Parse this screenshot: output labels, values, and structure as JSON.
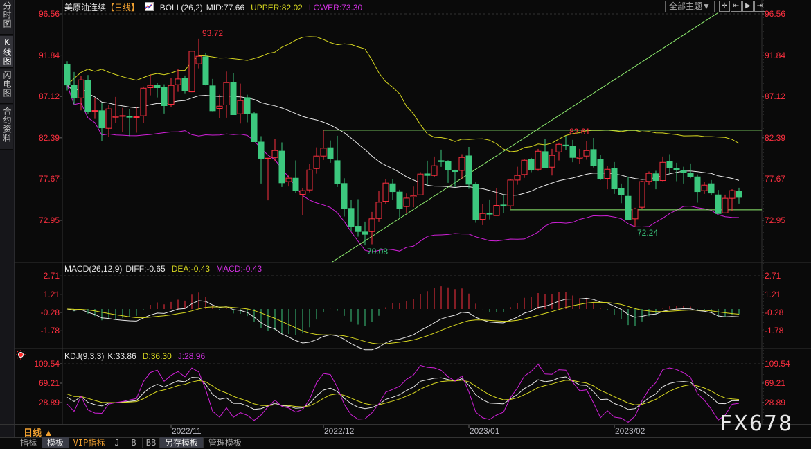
{
  "sidebar": {
    "tabs": [
      {
        "label": "分时图",
        "chars": [
          "分",
          "时",
          "图"
        ]
      },
      {
        "label": "K线图",
        "chars": [
          "K",
          "线",
          "图"
        ]
      },
      {
        "label": "闪电图",
        "chars": [
          "闪",
          "电",
          "图"
        ]
      },
      {
        "label": "合约资料",
        "chars": [
          "合",
          "约",
          "资",
          "料"
        ]
      }
    ]
  },
  "main_legend": {
    "symbol": "美原油连续",
    "period": "【日线】",
    "indicator": "BOLL(26,2)",
    "mid": "MID:77.66",
    "upper": "UPPER:82.02",
    "lower": "LOWER:73.30"
  },
  "toolbar": {
    "theme_select": "全部主题▼",
    "icons": [
      "crosshair-icon",
      "zoom-in-icon",
      "play-forward-icon",
      "exit-icon"
    ]
  },
  "macd_legend": {
    "name": "MACD(26,12,9)",
    "diff": "DIFF:-0.65",
    "dea": "DEA:-0.43",
    "macd": "MACD:-0.43"
  },
  "kdj_legend": {
    "name": "KDJ(9,3,3)",
    "k": "K:33.86",
    "d": "D:36.30",
    "j": "J:28.96"
  },
  "annotations": {
    "high": "93.72",
    "low": "70.08",
    "high2": "82.61",
    "low2": "72.24"
  },
  "period_button": "日线 ▲",
  "bottom_tabs": [
    "指标",
    "模板",
    "VIP指标",
    "J",
    "B",
    "BB",
    "另存模板",
    "管理模板"
  ],
  "watermark": "FX678",
  "colors": {
    "up": "#ff3040",
    "down": "#3cc87e",
    "mid": "#e8e8e8",
    "upper": "#d8d820",
    "lower": "#d020d8",
    "trend": "#90f070"
  },
  "chart_data": {
    "type": "candlestick",
    "title": "美原油连续【日线】",
    "price_axis": {
      "ticks": [
        96.56,
        91.84,
        87.12,
        82.39,
        77.67,
        72.95
      ],
      "range": [
        72.95,
        96.56
      ]
    },
    "macd_axis": {
      "ticks": [
        "2.71",
        "1.21",
        "-0.28",
        "-1.78"
      ],
      "values": [
        2.71,
        1.21,
        -0.28,
        -1.78
      ]
    },
    "kdj_axis": {
      "ticks": [
        "109.54",
        "69.21",
        "28.89"
      ],
      "values": [
        109.54,
        69.21,
        28.89
      ]
    },
    "date_ticks": [
      {
        "label": "2022/11",
        "index": 15
      },
      {
        "label": "2022/12",
        "index": 37
      },
      {
        "label": "2023/01",
        "index": 58
      },
      {
        "label": "2023/02",
        "index": 79
      }
    ],
    "trend_lines": [
      {
        "type": "horizontal",
        "price": 83.26,
        "from_index": 37
      },
      {
        "type": "horizontal",
        "price": 74.15,
        "from_index": 64
      },
      {
        "type": "segment",
        "from": [
          38.3,
          68.2
        ],
        "to": [
          94,
          96.7
        ]
      }
    ],
    "ohlc": [
      [
        90.76,
        91.15,
        87.8,
        88.43
      ],
      [
        88.38,
        89.91,
        86.22,
        86.93
      ],
      [
        86.95,
        89.49,
        85.53,
        89.01
      ],
      [
        88.96,
        89.57,
        85.08,
        85.42
      ],
      [
        85.48,
        86.98,
        84.55,
        85.5
      ],
      [
        85.48,
        86.43,
        82.04,
        83.52
      ],
      [
        83.47,
        86.14,
        82.52,
        85.69
      ],
      [
        84.74,
        87.06,
        84.1,
        84.84
      ],
      [
        84.9,
        85.8,
        83.05,
        84.92
      ],
      [
        84.84,
        85.69,
        82.57,
        84.74
      ],
      [
        84.74,
        85.87,
        82.97,
        84.79
      ],
      [
        84.9,
        88.25,
        84.08,
        88.06
      ],
      [
        88.12,
        89.65,
        87.24,
        88.38
      ],
      [
        88.38,
        88.64,
        87.0,
        88.12
      ],
      [
        88.17,
        88.51,
        85.16,
        86.06
      ],
      [
        86.22,
        89.22,
        85.87,
        88.38
      ],
      [
        88.46,
        90.23,
        87.64,
        89.12
      ],
      [
        89.22,
        89.52,
        87.48,
        87.8
      ],
      [
        87.64,
        92.3,
        87.6,
        92.29
      ],
      [
        90.84,
        93.72,
        90.33,
        91.71
      ],
      [
        91.65,
        92.07,
        88.38,
        88.49
      ],
      [
        88.33,
        89.12,
        85.42,
        85.48
      ],
      [
        85.74,
        87.32,
        84.63,
        86.0
      ],
      [
        86.14,
        89.96,
        84.68,
        88.7
      ],
      [
        88.72,
        89.75,
        85.03,
        85.03
      ],
      [
        85.13,
        88.59,
        84.02,
        86.64
      ],
      [
        86.98,
        87.32,
        84.16,
        85.19
      ],
      [
        85.16,
        85.34,
        81.94,
        81.94
      ],
      [
        81.9,
        82.57,
        77.16,
        80.04
      ],
      [
        80.0,
        80.1,
        75.23,
        80.06
      ],
      [
        80.14,
        82.23,
        79.67,
        80.93
      ],
      [
        80.86,
        81.86,
        76.76,
        77.24
      ],
      [
        77.37,
        78.14,
        76.82,
        77.77
      ],
      [
        77.76,
        79.8,
        76.1,
        76.36
      ],
      [
        75.92,
        76.63,
        73.54,
        76.34
      ],
      [
        76.42,
        79.4,
        76.15,
        78.71
      ],
      [
        78.87,
        81.3,
        78.29,
        80.3
      ],
      [
        80.3,
        83.23,
        79.85,
        81.2
      ],
      [
        81.25,
        82.09,
        79.53,
        80.01
      ],
      [
        79.77,
        82.62,
        76.76,
        77.16
      ],
      [
        77.16,
        77.76,
        73.38,
        74.33
      ],
      [
        74.31,
        75.26,
        71.74,
        72.27
      ],
      [
        72.27,
        75.36,
        71.08,
        71.66
      ],
      [
        71.61,
        72.8,
        70.08,
        71.35
      ],
      [
        71.66,
        73.91,
        70.21,
        73.12
      ],
      [
        73.17,
        76.29,
        72.8,
        75.02
      ],
      [
        75.12,
        77.66,
        74.78,
        77.21
      ],
      [
        77.13,
        77.66,
        75.28,
        76.23
      ],
      [
        76.18,
        76.44,
        73.28,
        74.33
      ],
      [
        74.52,
        76.02,
        73.8,
        75.49
      ],
      [
        75.63,
        76.81,
        74.44,
        75.78
      ],
      [
        75.86,
        78.45,
        75.84,
        78.24
      ],
      [
        78.26,
        79.77,
        77.02,
        78.08
      ],
      [
        78.08,
        80.25,
        77.87,
        79.19
      ],
      [
        79.77,
        81.04,
        79.06,
        79.66
      ],
      [
        79.72,
        79.82,
        77.24,
        78.69
      ],
      [
        78.66,
        78.74,
        76.76,
        78.53
      ],
      [
        78.66,
        80.51,
        77.68,
        80.14
      ],
      [
        80.32,
        81.35,
        76.55,
        77.08
      ],
      [
        77.08,
        77.29,
        72.67,
        73.06
      ],
      [
        73.06,
        74.83,
        72.4,
        73.72
      ],
      [
        73.78,
        75.33,
        73.06,
        73.65
      ],
      [
        73.49,
        76.6,
        73.49,
        74.65
      ],
      [
        74.7,
        75.81,
        73.78,
        74.57
      ],
      [
        74.6,
        77.68,
        74.25,
        77.55
      ],
      [
        77.55,
        79.08,
        77.02,
        78.08
      ],
      [
        78.19,
        79.93,
        77.8,
        79.82
      ],
      [
        79.93,
        80.09,
        78.45,
        78.69
      ],
      [
        78.79,
        81.12,
        78.61,
        80.85
      ],
      [
        80.8,
        82.3,
        78.93,
        78.98
      ],
      [
        79.03,
        81.12,
        78.08,
        80.38
      ],
      [
        80.77,
        81.83,
        79.8,
        81.64
      ],
      [
        81.56,
        82.61,
        80.98,
        81.46
      ],
      [
        81.41,
        82.15,
        79.59,
        80.14
      ],
      [
        80.06,
        81.12,
        79.4,
        80.19
      ],
      [
        80.3,
        81.99,
        79.88,
        80.93
      ],
      [
        81.04,
        82.38,
        79.0,
        79.24
      ],
      [
        79.93,
        80.4,
        77.55,
        77.66
      ],
      [
        77.74,
        79.14,
        76.5,
        78.79
      ],
      [
        78.9,
        79.61,
        75.97,
        76.55
      ],
      [
        76.6,
        77.16,
        74.91,
        75.84
      ],
      [
        75.7,
        77.95,
        73.06,
        73.06
      ],
      [
        73.12,
        74.38,
        72.24,
        74.25
      ],
      [
        74.44,
        77.47,
        74.25,
        77.37
      ],
      [
        77.4,
        78.53,
        77.0,
        78.32
      ],
      [
        78.27,
        78.61,
        76.5,
        77.5
      ],
      [
        77.5,
        80.25,
        77.42,
        79.58
      ],
      [
        79.66,
        80.51,
        78.29,
        79.0
      ],
      [
        78.87,
        79.53,
        77.42,
        78.69
      ],
      [
        78.64,
        79.08,
        77.16,
        78.4
      ],
      [
        78.32,
        79.45,
        77.76,
        77.9
      ],
      [
        77.92,
        78.21,
        74.97,
        76.23
      ],
      [
        76.34,
        77.37,
        75.97,
        76.97
      ],
      [
        77.13,
        77.55,
        75.81,
        76.07
      ],
      [
        75.86,
        76.42,
        73.72,
        73.72
      ],
      [
        73.8,
        75.89,
        73.8,
        75.47
      ],
      [
        75.47,
        76.5,
        73.99,
        76.34
      ],
      [
        76.28,
        76.68,
        74.86,
        75.57
      ]
    ]
  }
}
